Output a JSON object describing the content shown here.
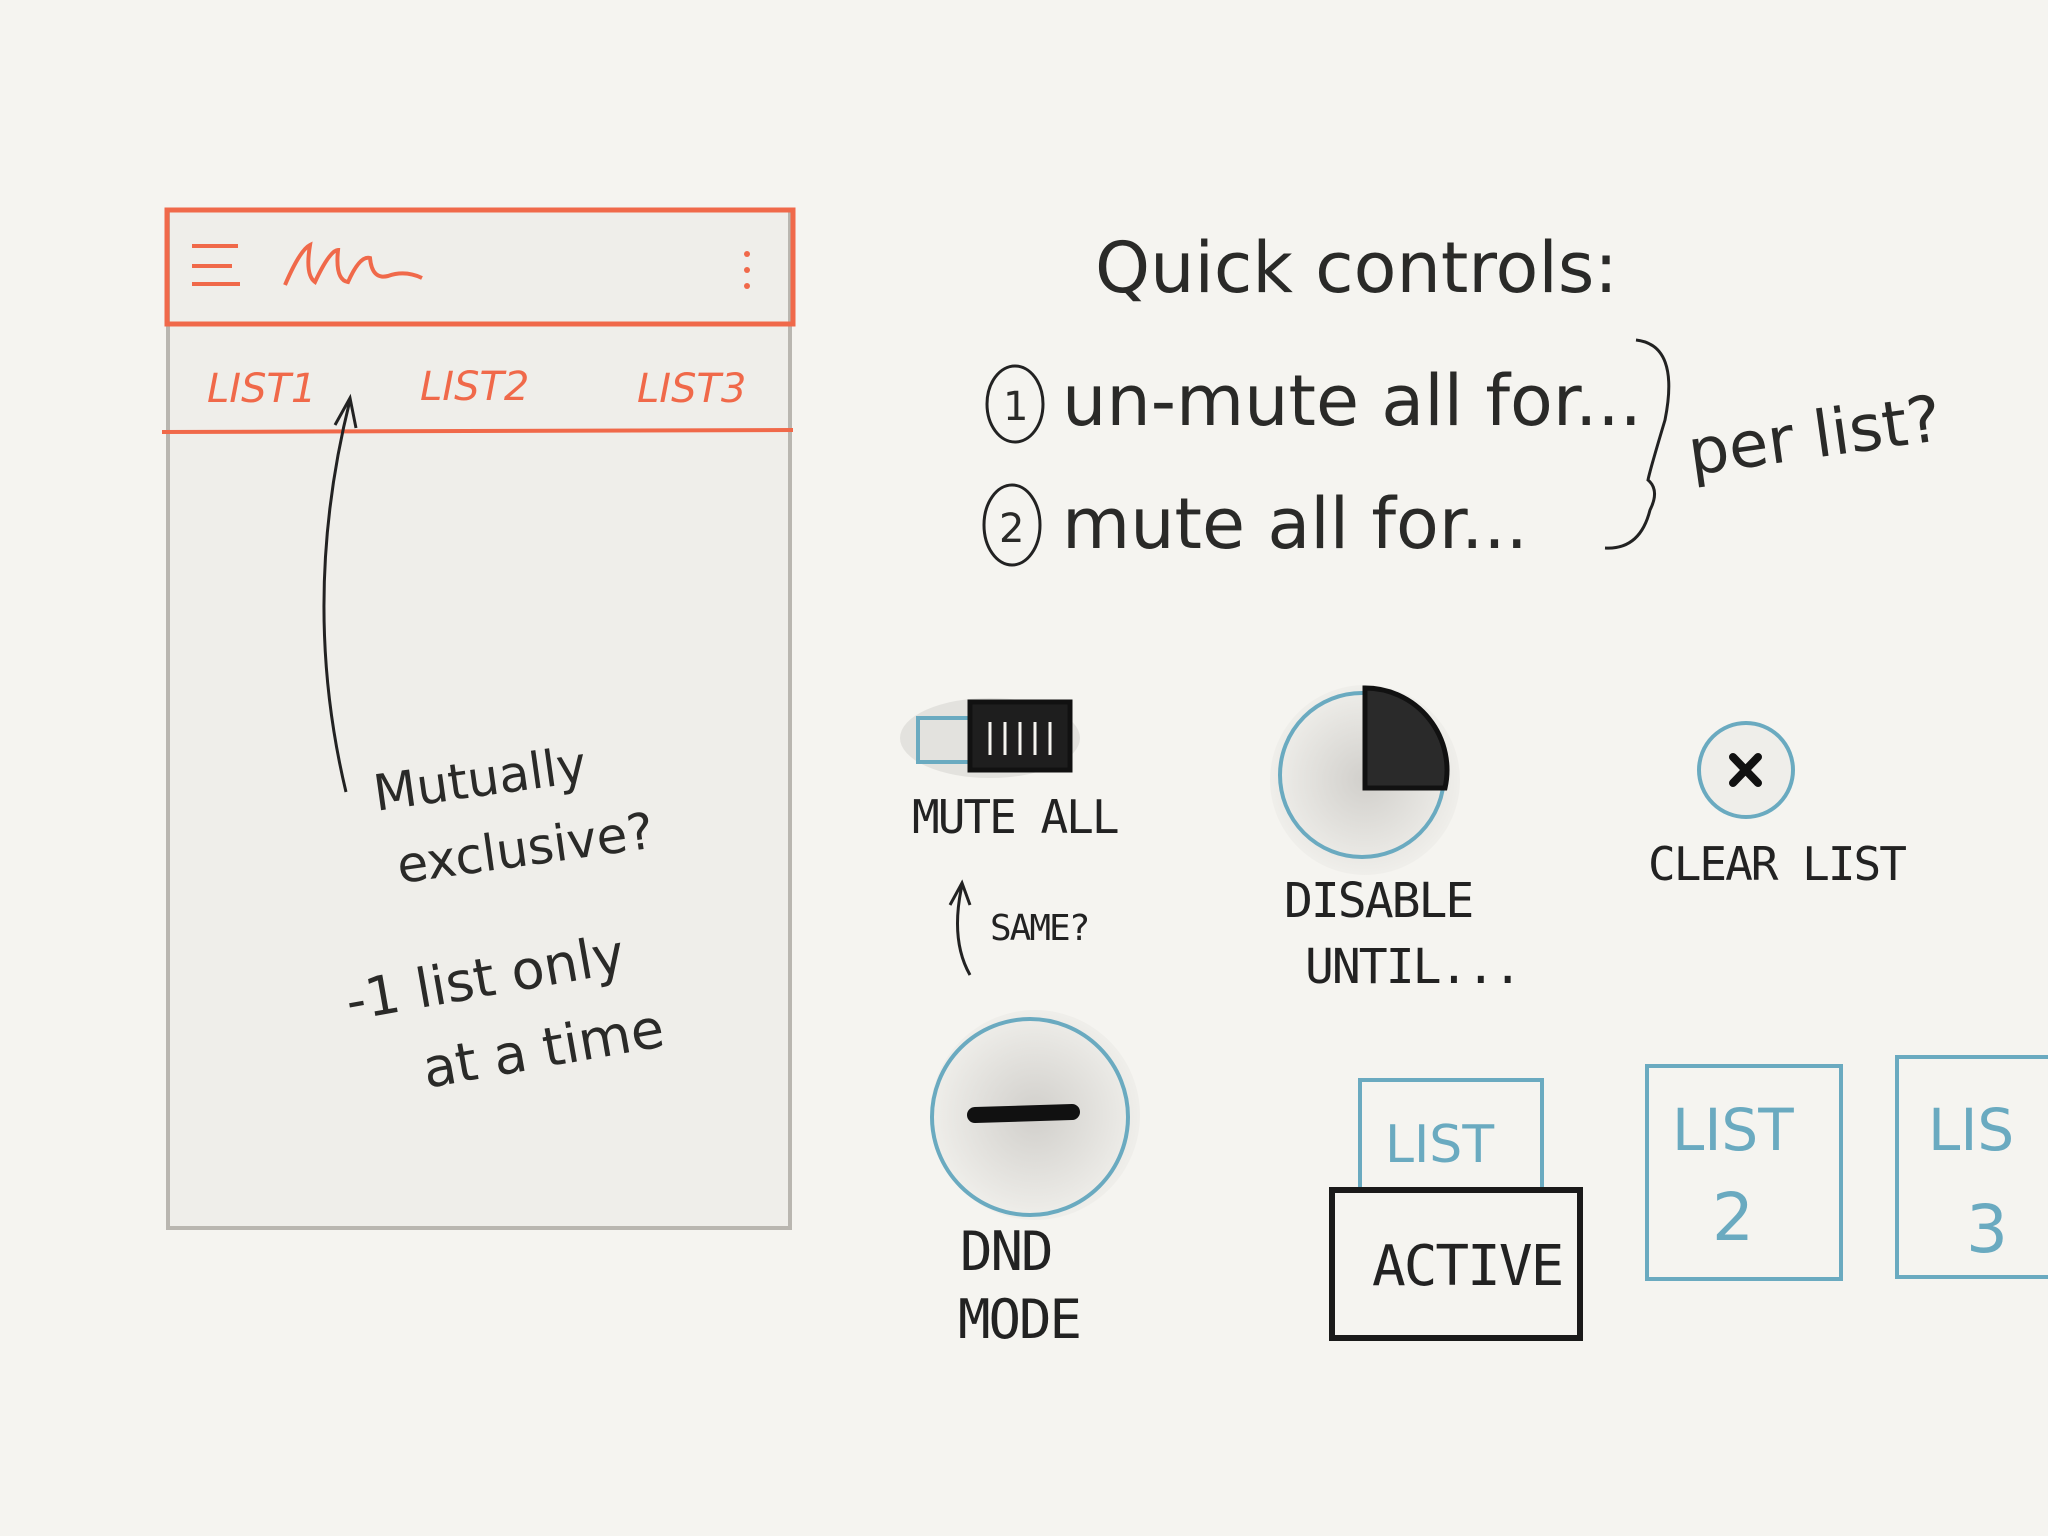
{
  "phone": {
    "tabs": [
      "LIST1",
      "LIST2",
      "LIST3"
    ],
    "annotation": {
      "line1": "Mutually",
      "line2": "exclusive?",
      "line3": "-1 list only",
      "line4": "at a time"
    }
  },
  "quick_controls": {
    "title": "Quick controls:",
    "items": [
      {
        "number": "1",
        "text": "un-mute all for..."
      },
      {
        "number": "2",
        "text": "mute all for..."
      }
    ],
    "brace_note": "per list?"
  },
  "controls": {
    "mute_all": {
      "label": "MUTE ALL",
      "note": "SAME?"
    },
    "disable_until": {
      "label1": "DISABLE",
      "label2": "UNTIL..."
    },
    "clear_list": {
      "label": "CLEAR LIST"
    },
    "dnd_mode": {
      "label1": "DND",
      "label2": "MODE"
    },
    "list_cards": [
      {
        "label": "LIST",
        "sub": "ACTIVE"
      },
      {
        "label": "LIST",
        "sub": "2"
      },
      {
        "label": "LIS",
        "sub": "3"
      }
    ]
  },
  "colors": {
    "accent": "#f0694a",
    "blue": "#6aaac0",
    "ink": "#222222",
    "paper": "#f5f4f0"
  }
}
